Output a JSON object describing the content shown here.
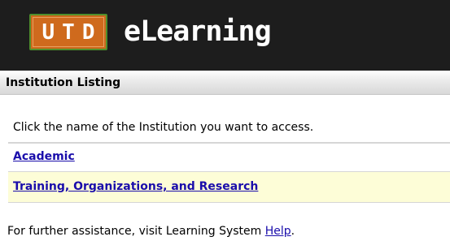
{
  "header": {
    "logo_text": "UTD",
    "brand": "eLearning"
  },
  "institution_listing": {
    "title": "Institution Listing",
    "instruction": "Click the name of the Institution you want to access.",
    "institutions": [
      {
        "label": "Academic"
      },
      {
        "label": "Training, Organizations, and Research"
      }
    ]
  },
  "footer": {
    "text": "For further assistance, visit Learning System ",
    "help_link": "Help",
    "trailing": "."
  },
  "colors": {
    "banner_bg": "#1d1d1d",
    "logo_orange": "#cf6a1d",
    "logo_green": "#4f8f2c",
    "link": "#1a0dab",
    "highlight_row": "#fdfdd7"
  }
}
